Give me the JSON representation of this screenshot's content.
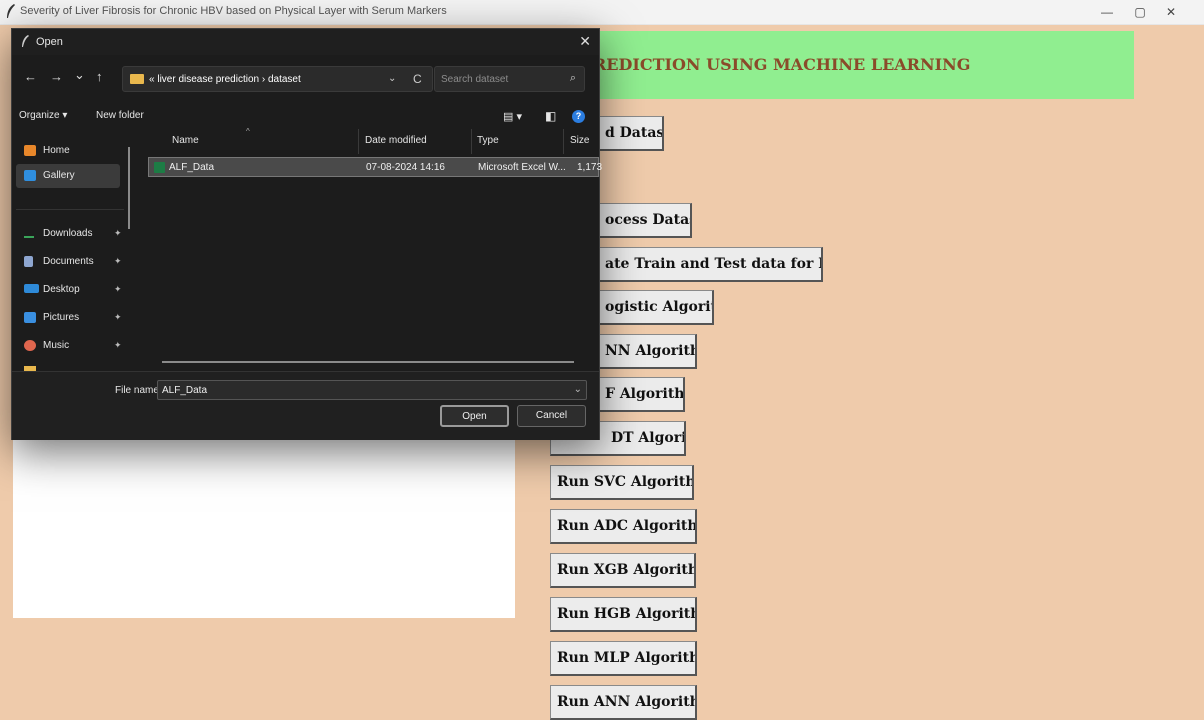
{
  "window": {
    "title": "Severity of Liver Fibrosis for Chronic HBV based on Physical Layer with Serum Markers",
    "controls": {
      "minimize": "—",
      "maximize": "▢",
      "close": "✕"
    }
  },
  "app": {
    "banner_text": "REDICTION USING MACHINE LEARNING",
    "buttons": [
      {
        "id": "upload",
        "label": "d Dataset"
      },
      {
        "id": "preprocess",
        "label": "ocess Dataset"
      },
      {
        "id": "split",
        "label": "ate Train and Test data for Model"
      },
      {
        "id": "logistic",
        "label": "ogistic Algorithm"
      },
      {
        "id": "knn",
        "label": "NN Algorithm"
      },
      {
        "id": "rf",
        "label": "F Algorithm"
      },
      {
        "id": "dt",
        "label": "DT Algorithm"
      },
      {
        "id": "svc",
        "label": "Run SVC Algorithm"
      },
      {
        "id": "adc",
        "label": "Run ADC Algorithm"
      },
      {
        "id": "xgb",
        "label": "Run XGB Algorithm"
      },
      {
        "id": "hgb",
        "label": "Run HGB Algorithm"
      },
      {
        "id": "mlp",
        "label": "Run MLP Algorithm"
      },
      {
        "id": "ann",
        "label": "Run ANN Algorithm"
      }
    ]
  },
  "dialog": {
    "title": "Open",
    "close": "✕",
    "nav": {
      "back": "←",
      "forward": "→",
      "recent": "⌄",
      "up": "↑"
    },
    "address": {
      "prefix": "«",
      "crumb1": "liver disease prediction",
      "sep": "›",
      "crumb2": "dataset",
      "dropdown": "⌄",
      "refresh": "C"
    },
    "search": {
      "placeholder": "Search dataset",
      "icon": "⌕"
    },
    "toolbar": {
      "organize": "Organize ▾",
      "new_folder": "New folder",
      "view": "▤ ▾",
      "pane": "◧",
      "help": "?"
    },
    "sidebar": [
      {
        "label": "Home",
        "icon": "home-icon",
        "color": "#e8872a",
        "pinned": false
      },
      {
        "label": "Gallery",
        "icon": "gallery-icon",
        "color": "#2f8fe0",
        "pinned": false
      },
      {
        "label": "Downloads",
        "icon": "download-icon",
        "color": "#3aa55a",
        "pinned": true
      },
      {
        "label": "Documents",
        "icon": "document-icon",
        "color": "#8ea6d0",
        "pinned": true
      },
      {
        "label": "Desktop",
        "icon": "desktop-icon",
        "color": "#2e8ad8",
        "pinned": true
      },
      {
        "label": "Pictures",
        "icon": "pictures-icon",
        "color": "#3a8fe0",
        "pinned": true
      },
      {
        "label": "Music",
        "icon": "music-icon",
        "color": "#e0664e",
        "pinned": true
      }
    ],
    "pin_glyph": "✦",
    "columns": {
      "name": "Name",
      "sort_arrow": "^",
      "date": "Date modified",
      "type": "Type",
      "size": "Size"
    },
    "files": [
      {
        "name": "ALF_Data",
        "date": "07-08-2024 14:16",
        "type": "Microsoft Excel W...",
        "size": "1,173"
      }
    ],
    "filename_label": "File name:",
    "filename_value": "ALF_Data",
    "filename_dropdown": "⌄",
    "open_label": "Open",
    "cancel_label": "Cancel"
  }
}
